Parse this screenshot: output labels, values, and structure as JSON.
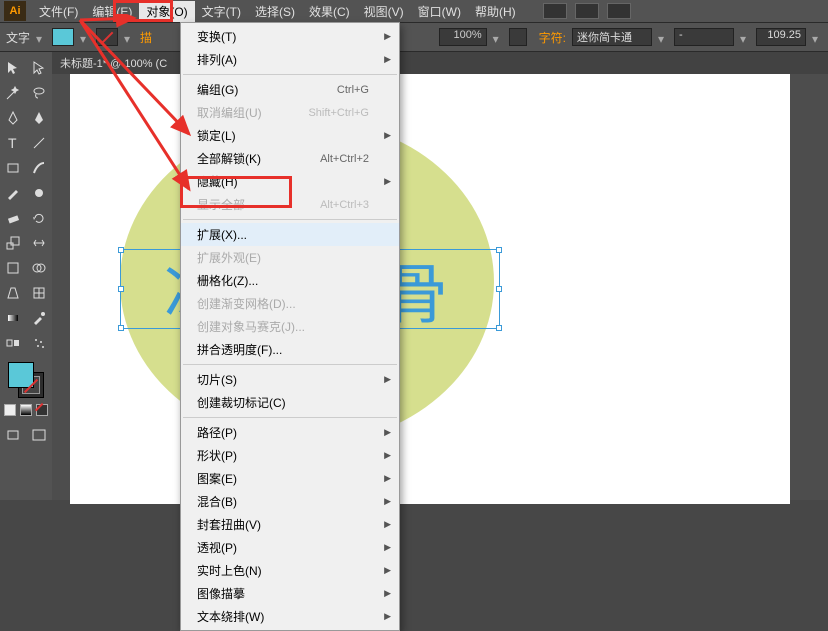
{
  "menubar": {
    "logo": "Ai",
    "items": [
      {
        "label": "文件(F)"
      },
      {
        "label": "编辑(E)"
      },
      {
        "label": "对象(O)"
      },
      {
        "label": "文字(T)"
      },
      {
        "label": "选择(S)"
      },
      {
        "label": "效果(C)"
      },
      {
        "label": "视图(V)"
      },
      {
        "label": "窗口(W)"
      },
      {
        "label": "帮助(H)"
      }
    ]
  },
  "controlbar": {
    "type_label": "文字",
    "stroke_char": "描",
    "zoom": "100%",
    "chars_label": "字符:",
    "font_name": "迷你简卡通",
    "rotation": "109.25"
  },
  "tab": {
    "title": "未标题-1* @ 100% (C"
  },
  "dropdown": {
    "items": [
      {
        "label": "变换(T)",
        "sub": true
      },
      {
        "label": "排列(A)",
        "sub": true
      },
      {
        "sep": true
      },
      {
        "label": "编组(G)",
        "shortcut": "Ctrl+G"
      },
      {
        "label": "取消编组(U)",
        "shortcut": "Shift+Ctrl+G",
        "disabled": true
      },
      {
        "label": "锁定(L)",
        "sub": true
      },
      {
        "label": "全部解锁(K)",
        "shortcut": "Alt+Ctrl+2"
      },
      {
        "label": "隐藏(H)",
        "sub": true
      },
      {
        "label": "显示全部",
        "shortcut": "Alt+Ctrl+3",
        "disabled": true
      },
      {
        "sep": true
      },
      {
        "label": "扩展(X)...",
        "highlight": true
      },
      {
        "label": "扩展外观(E)",
        "disabled": true
      },
      {
        "label": "栅格化(Z)..."
      },
      {
        "label": "创建渐变网格(D)...",
        "disabled": true
      },
      {
        "label": "创建对象马赛克(J)...",
        "disabled": true
      },
      {
        "label": "拼合透明度(F)..."
      },
      {
        "sep": true
      },
      {
        "label": "切片(S)",
        "sub": true
      },
      {
        "label": "创建裁切标记(C)"
      },
      {
        "sep": true
      },
      {
        "label": "路径(P)",
        "sub": true
      },
      {
        "label": "形状(P)",
        "sub": true
      },
      {
        "label": "图案(E)",
        "sub": true
      },
      {
        "label": "混合(B)",
        "sub": true
      },
      {
        "label": "封套扭曲(V)",
        "sub": true
      },
      {
        "label": "透视(P)",
        "sub": true
      },
      {
        "label": "实时上色(N)",
        "sub": true
      },
      {
        "label": "图像描摹",
        "sub": true
      },
      {
        "label": "文本绕排(W)",
        "sub": true
      }
    ]
  },
  "canvas": {
    "text": "冰霜刺骨"
  }
}
